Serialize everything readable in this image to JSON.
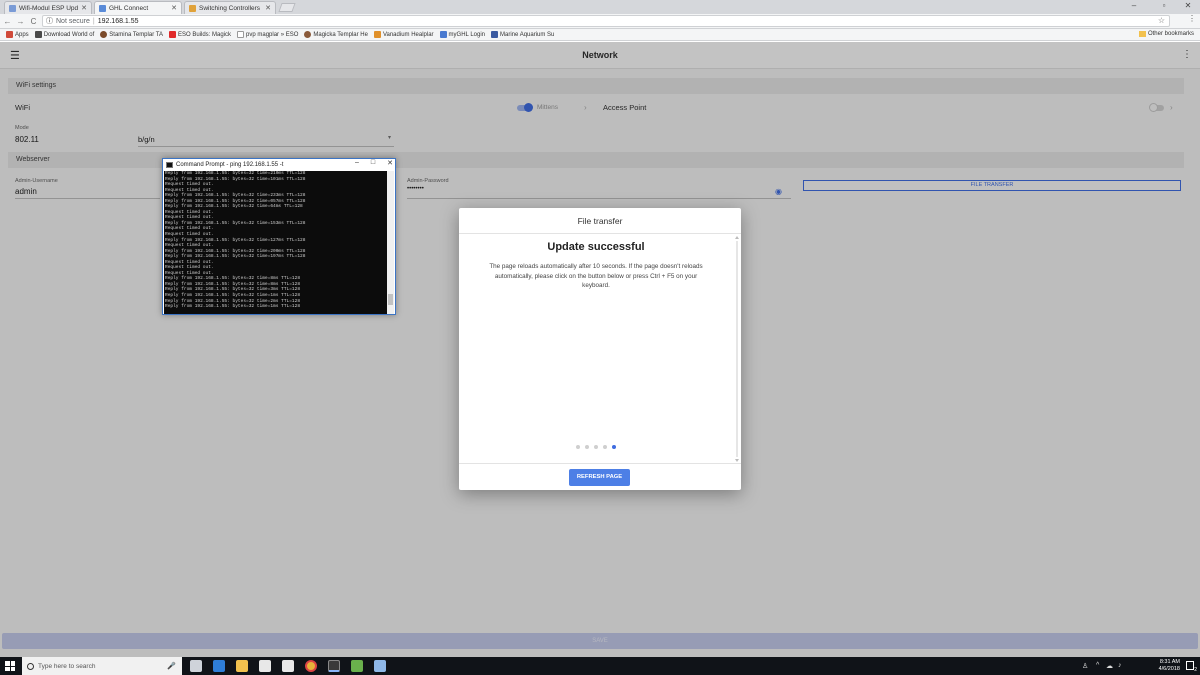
{
  "browser": {
    "tabs": [
      {
        "label": "Wifi-Modul ESP Updat",
        "color": "#7a9bd6"
      },
      {
        "label": "GHL Connect",
        "color": "#5a8bd8"
      },
      {
        "label": "Switching Controllers | F",
        "color": "#e0a23a"
      }
    ],
    "window_controls": {
      "minimize": "–",
      "restore": "▫",
      "close": "✕"
    },
    "nav": {
      "back": "←",
      "forward": "→",
      "reload": "C"
    },
    "omnibox": {
      "security": "Not secure",
      "url": "192.168.1.55"
    },
    "bookmarks": [
      {
        "label": "Apps",
        "color": "#d04a3a"
      },
      {
        "label": "Download World of",
        "color": "#4a4a4a"
      },
      {
        "label": "Stamina Templar TA",
        "color": "#7b4a2a"
      },
      {
        "label": "ESO Builds: Magick",
        "color": "#e02a2a"
      },
      {
        "label": "pvp magplar » ESO",
        "color": "#ffffff"
      },
      {
        "label": "Magicka Templar He",
        "color": "#8a5a3a"
      },
      {
        "label": "Vanadium Healplar",
        "color": "#e0902a"
      },
      {
        "label": "myGHL Login",
        "color": "#4a7ad0"
      },
      {
        "label": "Marine Aquarium Su",
        "color": "#3a5aa0"
      }
    ],
    "other_bookmarks": "Other bookmarks"
  },
  "app": {
    "title": "Network",
    "wifi_settings": {
      "section_title": "WiFi settings",
      "wifi_label": "WiFi",
      "wifi_toggle_label": "Mittens",
      "wifi_on": true,
      "access_point_label": "Access Point",
      "access_point_on": false,
      "mode_label": "Mode",
      "mode_value": "802.11",
      "mode_select": "b/g/n"
    },
    "webserver": {
      "section_title": "Webserver",
      "username_label": "Admin-Username",
      "username_value": "admin",
      "password_label": "Admin-Password",
      "password_value": "••••••••",
      "file_transfer_button": "FILE TRANSFER"
    },
    "save_button": "SAVE"
  },
  "cmd": {
    "title": "Command Prompt - ping  192.168.1.55 -t",
    "lines": [
      "Reply from 192.168.1.55: bytes=32 time=210ms TTL=128",
      "Reply from 192.168.1.55: bytes=32 time=101ms TTL=128",
      "Request timed out.",
      "Request timed out.",
      "Reply from 192.168.1.55: bytes=32 time=233ms TTL=128",
      "Reply from 192.168.1.55: bytes=32 time=057ms TTL=128",
      "Reply from 192.168.1.55: bytes=32 time=64ms TTL=128",
      "Request timed out.",
      "Request timed out.",
      "Reply from 192.168.1.55: bytes=32 time=153ms TTL=128",
      "Request timed out.",
      "Request timed out.",
      "Reply from 192.168.1.55: bytes=32 time=127ms TTL=128",
      "Request timed out.",
      "Reply from 192.168.1.55: bytes=32 time=200ms TTL=128",
      "Reply from 192.168.1.55: bytes=32 time=197ms TTL=128",
      "Request timed out.",
      "Request timed out.",
      "Request timed out.",
      "Reply from 192.168.1.55: bytes=32 time=8ms TTL=128",
      "Reply from 192.168.1.55: bytes=32 time=8ms TTL=128",
      "Reply from 192.168.1.55: bytes=32 time=3ms TTL=128",
      "Reply from 192.168.1.55: bytes=32 time=1ms TTL=128",
      "Reply from 192.168.1.55: bytes=32 time=2ms TTL=128",
      "Reply from 192.168.1.55: bytes=32 time=1ms TTL=128"
    ]
  },
  "modal": {
    "header": "File transfer",
    "title": "Update successful",
    "message": "The page reloads automatically after 10 seconds. If the page doesn't reloads automatically, please click on the button below or press Ctrl + F5 on your keyboard.",
    "dots_total": 5,
    "dots_active_index": 4,
    "refresh_button": "REFRESH PAGE"
  },
  "taskbar": {
    "search_placeholder": "Type here to search",
    "apps": [
      {
        "name": "task-view-icon",
        "color": "#cfd3da"
      },
      {
        "name": "edge-icon",
        "color": "#2f7ed8"
      },
      {
        "name": "file-explorer-icon",
        "color": "#f2c14e"
      },
      {
        "name": "store-icon",
        "color": "#e8e8e8"
      },
      {
        "name": "mail-icon",
        "color": "#e8e8e8"
      },
      {
        "name": "chrome-icon",
        "color": "#e8b33a"
      },
      {
        "name": "cmd-icon",
        "color": "#3a3a3a"
      },
      {
        "name": "app-green-icon",
        "color": "#6ab04c"
      },
      {
        "name": "app-blue-icon",
        "color": "#8fb8e8"
      }
    ],
    "time": "8:31 AM",
    "date": "4/6/2018",
    "notification_count": "2"
  },
  "colors": {
    "accent": "#3f6ce0",
    "refresh_bg": "#4d7fe6",
    "save_bar": "#c2c8e8"
  }
}
